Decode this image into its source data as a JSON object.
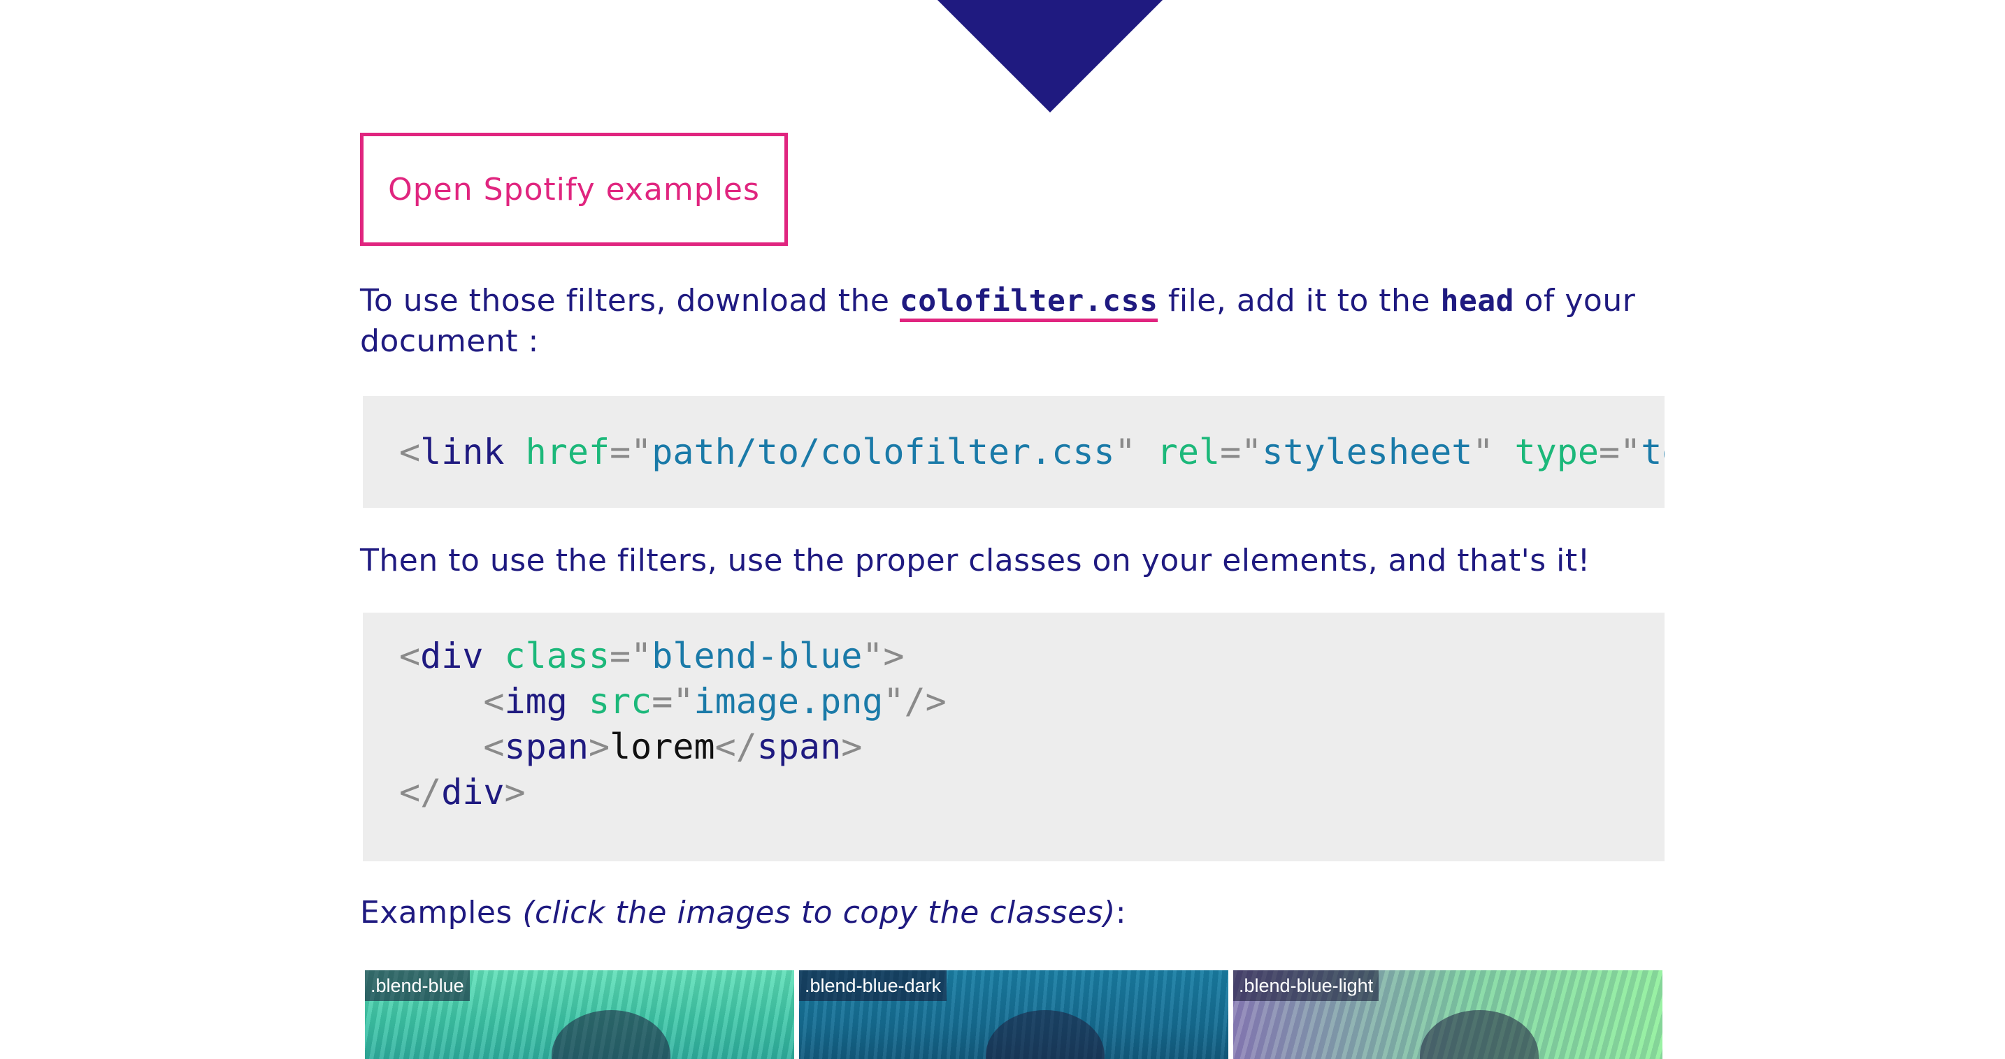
{
  "button": {
    "label": "Open Spotify examples"
  },
  "intro": {
    "prefix": "To use those filters, download the ",
    "file_link": "colofilter.css",
    "middle": " file, add it to the ",
    "head_code": "head",
    "suffix": " of your document :"
  },
  "code1": {
    "tag": "link",
    "href_attr": "href",
    "href_val": "path/to/colofilter.css",
    "rel_attr": "rel",
    "rel_val": "stylesheet",
    "type_attr": "type",
    "type_val": "text"
  },
  "usage": {
    "text": "Then to use the filters, use the proper classes on your elements, and that's it!"
  },
  "code2": {
    "div_tag": "div",
    "class_attr": "class",
    "class_val": "blend-blue",
    "img_tag": "img",
    "src_attr": "src",
    "src_val": "image.png",
    "span_tag": "span",
    "span_text": "lorem"
  },
  "examples": {
    "prefix": "Examples ",
    "hint": "(click the images to copy the classes)",
    "suffix": ":"
  },
  "gallery": [
    {
      "label": ".blend-blue"
    },
    {
      "label": ".blend-blue-dark"
    },
    {
      "label": ".blend-blue-light"
    }
  ],
  "colors": {
    "accent": "#e0257f",
    "primary": "#1f1a80",
    "code_bg": "#ededed"
  }
}
